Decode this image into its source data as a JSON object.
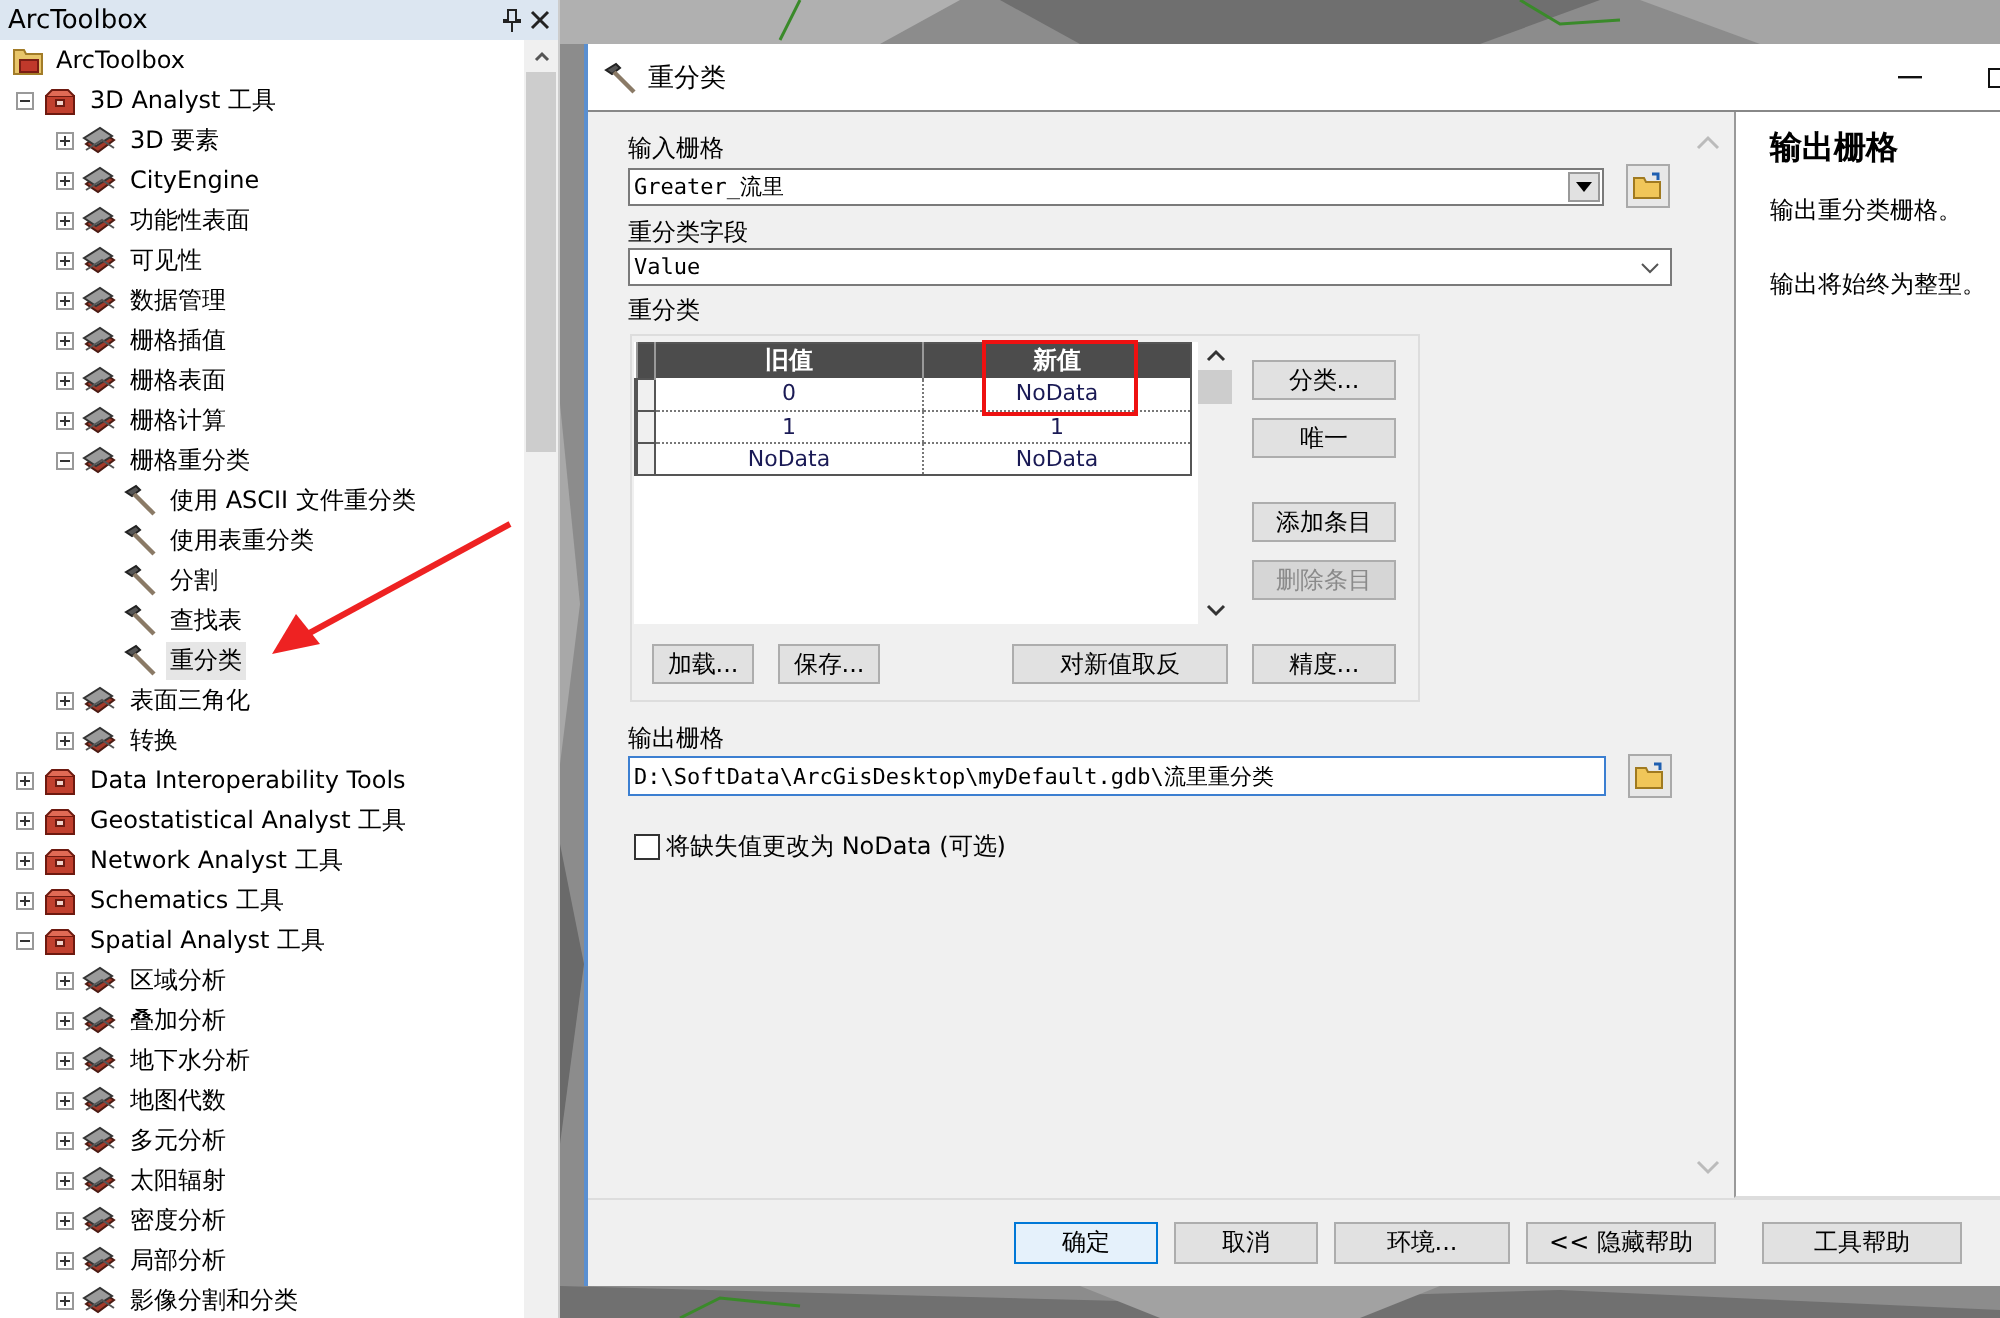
{
  "toolbox_panel": {
    "title": "ArcToolbox"
  },
  "tree": [
    {
      "label": "ArcToolbox",
      "kind": "root",
      "selected": false,
      "children": [
        {
          "label": "3D Analyst 工具",
          "kind": "toolbox",
          "expanded": true,
          "selected": false,
          "children": [
            {
              "label": "3D 要素",
              "kind": "toolset",
              "expanded": false,
              "selected": false
            },
            {
              "label": "CityEngine",
              "kind": "toolset",
              "expanded": false,
              "selected": false
            },
            {
              "label": "功能性表面",
              "kind": "toolset",
              "expanded": false,
              "selected": false
            },
            {
              "label": "可见性",
              "kind": "toolset",
              "expanded": false,
              "selected": false
            },
            {
              "label": "数据管理",
              "kind": "toolset",
              "expanded": false,
              "selected": false
            },
            {
              "label": "栅格插值",
              "kind": "toolset",
              "expanded": false,
              "selected": false
            },
            {
              "label": "栅格表面",
              "kind": "toolset",
              "expanded": false,
              "selected": false
            },
            {
              "label": "栅格计算",
              "kind": "toolset",
              "expanded": false,
              "selected": false
            },
            {
              "label": "栅格重分类",
              "kind": "toolset",
              "expanded": true,
              "selected": false,
              "children": [
                {
                  "label": "使用 ASCII 文件重分类",
                  "kind": "tool",
                  "selected": false
                },
                {
                  "label": "使用表重分类",
                  "kind": "tool",
                  "selected": false
                },
                {
                  "label": "分割",
                  "kind": "tool",
                  "selected": false
                },
                {
                  "label": "查找表",
                  "kind": "tool",
                  "selected": false
                },
                {
                  "label": "重分类",
                  "kind": "tool",
                  "selected": true
                }
              ]
            },
            {
              "label": "表面三角化",
              "kind": "toolset",
              "expanded": false,
              "selected": false
            },
            {
              "label": "转换",
              "kind": "toolset",
              "expanded": false,
              "selected": false
            }
          ]
        },
        {
          "label": "Data Interoperability Tools",
          "kind": "toolbox",
          "expanded": false,
          "selected": false
        },
        {
          "label": "Geostatistical Analyst 工具",
          "kind": "toolbox",
          "expanded": false,
          "selected": false
        },
        {
          "label": "Network Analyst 工具",
          "kind": "toolbox",
          "expanded": false,
          "selected": false
        },
        {
          "label": "Schematics 工具",
          "kind": "toolbox",
          "expanded": false,
          "selected": false
        },
        {
          "label": "Spatial Analyst 工具",
          "kind": "toolbox",
          "expanded": true,
          "selected": false,
          "children": [
            {
              "label": "区域分析",
              "kind": "toolset",
              "expanded": false,
              "selected": false
            },
            {
              "label": "叠加分析",
              "kind": "toolset",
              "expanded": false,
              "selected": false
            },
            {
              "label": "地下水分析",
              "kind": "toolset",
              "expanded": false,
              "selected": false
            },
            {
              "label": "地图代数",
              "kind": "toolset",
              "expanded": false,
              "selected": false
            },
            {
              "label": "多元分析",
              "kind": "toolset",
              "expanded": false,
              "selected": false
            },
            {
              "label": "太阳辐射",
              "kind": "toolset",
              "expanded": false,
              "selected": false
            },
            {
              "label": "密度分析",
              "kind": "toolset",
              "expanded": false,
              "selected": false
            },
            {
              "label": "局部分析",
              "kind": "toolset",
              "expanded": false,
              "selected": false
            },
            {
              "label": "影像分割和分类",
              "kind": "toolset",
              "expanded": false,
              "selected": false
            }
          ]
        }
      ]
    }
  ],
  "dialog": {
    "title": "重分类",
    "input_raster": {
      "label": "输入栅格",
      "value": "Greater_流里"
    },
    "reclass_field": {
      "label": "重分类字段",
      "value": "Value"
    },
    "reclassification": {
      "label": "重分类",
      "columns": [
        "旧值",
        "新值"
      ],
      "rows": [
        {
          "old": "0",
          "new": "NoData"
        },
        {
          "old": "1",
          "new": "1"
        },
        {
          "old": "NoData",
          "new": "NoData"
        }
      ],
      "side_buttons": [
        {
          "label": "分类...",
          "disabled": false
        },
        {
          "label": "唯一",
          "disabled": false
        },
        {
          "label": "添加条目",
          "disabled": false
        },
        {
          "label": "删除条目",
          "disabled": true
        }
      ],
      "bottom_buttons": [
        {
          "label": "加载...",
          "disabled": false
        },
        {
          "label": "保存...",
          "disabled": false
        },
        {
          "label": "对新值取反",
          "disabled": false
        },
        {
          "label": "精度...",
          "disabled": false
        }
      ]
    },
    "output_raster": {
      "label": "输出栅格",
      "value": "D:\\SoftData\\ArcGisDesktop\\myDefault.gdb\\流里重分类"
    },
    "missing_to_nodata": {
      "label": "将缺失值更改为 NoData (可选)",
      "checked": false
    },
    "help": {
      "heading": "输出栅格",
      "paragraphs": [
        "输出重分类栅格。",
        "输出将始终为整型。"
      ]
    },
    "footer_buttons": [
      {
        "label": "确定",
        "default": true
      },
      {
        "label": "取消",
        "default": false
      },
      {
        "label": "环境...",
        "default": false
      },
      {
        "label": "<< 隐藏帮助",
        "default": false
      },
      {
        "label": "工具帮助",
        "default": false
      }
    ]
  }
}
